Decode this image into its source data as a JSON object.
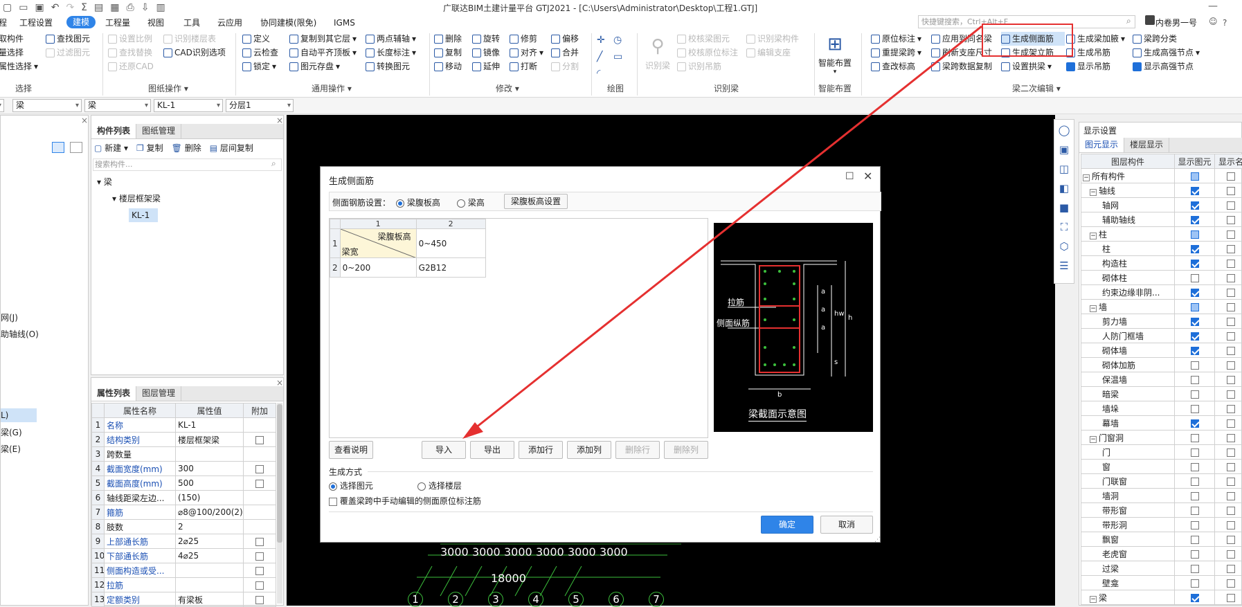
{
  "title": "广联达BIM土建计量平台 GTJ2021 - [C:\\Users\\Administrator\\Desktop\\工程1.GTJ]",
  "search_placeholder": "快捷键搜索，Ctrl+Alt+F",
  "user": "内卷男一号",
  "help": "?",
  "menu": [
    "程",
    "工程设置",
    "建模",
    "工程量",
    "视图",
    "工具",
    "云应用",
    "协同建模(限免)",
    "IGMS"
  ],
  "ribbon": {
    "select": {
      "items": [
        "取构件",
        "量选择",
        "属性选择",
        "查找图元",
        "过滤图元"
      ],
      "label": "选择"
    },
    "drawing": {
      "items": [
        "设置比例",
        "查找替换",
        "还原CAD",
        "识别楼层表",
        "CAD识别选项"
      ],
      "label": "图纸操作"
    },
    "common": {
      "items": [
        "定义",
        "云检查",
        "锁定",
        "复制到其它层",
        "自动平齐顶板",
        "图元存盘",
        "两点辅轴",
        "长度标注",
        "转换图元"
      ],
      "label": "通用操作"
    },
    "modify": {
      "items": [
        "删除",
        "复制",
        "移动",
        "旋转",
        "镜像",
        "延伸",
        "修剪",
        "对齐",
        "打断",
        "偏移",
        "合并",
        "分割"
      ],
      "label": "修改"
    },
    "draw": {
      "label": "绘图"
    },
    "identify": {
      "big": "识别梁",
      "items": [
        "校核梁图元",
        "校核原位标注",
        "识别吊筋",
        "编辑支座",
        "识别梁构件"
      ],
      "label": "识别梁"
    },
    "smart": {
      "big": "智能布置",
      "label": "智能布置"
    },
    "beam2": {
      "items": [
        "原位标注",
        "重提梁跨",
        "查改标高",
        "应用到同名梁",
        "刷新支座尺寸",
        "梁跨数据复制",
        "生成侧面筋",
        "生成架立筋",
        "设置拱梁",
        "生成梁加腋",
        "生成吊筋",
        "显示吊筋",
        "梁跨分类",
        "生成高强节点",
        "显示高强节点"
      ],
      "label": "梁二次编辑"
    }
  },
  "selectbar": [
    "梁",
    "梁",
    "KL-1",
    "分层1"
  ],
  "left_list": [
    "网(J)",
    "助轴线(O)",
    "L)",
    "梁(G)",
    "梁(E)"
  ],
  "component_panel": {
    "tabs": [
      "构件列表",
      "图纸管理"
    ],
    "toolbar": [
      "新建",
      "复制",
      "删除",
      "层间复制"
    ],
    "search_placeholder": "搜索构件...",
    "tree": [
      "梁",
      "楼层框架梁",
      "KL-1"
    ]
  },
  "property_panel": {
    "tabs": [
      "属性列表",
      "图层管理"
    ],
    "headers": [
      "属性名称",
      "属性值",
      "附加"
    ],
    "rows": [
      [
        "1",
        "名称",
        "KL-1"
      ],
      [
        "2",
        "结构类别",
        "楼层框架梁"
      ],
      [
        "3",
        "跨数量",
        ""
      ],
      [
        "4",
        "截面宽度(mm)",
        "300"
      ],
      [
        "5",
        "截面高度(mm)",
        "500"
      ],
      [
        "6",
        "轴线距梁左边...",
        "(150)"
      ],
      [
        "7",
        "箍筋",
        "⌀8@100/200(2)"
      ],
      [
        "8",
        "肢数",
        "2"
      ],
      [
        "9",
        "上部通长筋",
        "2⌀25"
      ],
      [
        "10",
        "下部通长筋",
        "4⌀25"
      ],
      [
        "11",
        "侧面构造或受...",
        ""
      ],
      [
        "12",
        "拉筋",
        ""
      ],
      [
        "13",
        "定额类别",
        "有梁板"
      ]
    ]
  },
  "dialog": {
    "title": "生成侧面筋",
    "setting_label": "侧面钢筋设置：",
    "opt1": "梁腹板高",
    "opt2": "梁高",
    "setting_btn": "梁腹板高设置",
    "table": {
      "cols": [
        "1",
        "2"
      ],
      "corner_top": "梁腹板高",
      "corner_bottom": "梁宽",
      "rows": [
        [
          "1",
          "",
          "0~450"
        ],
        [
          "2",
          "0~200",
          "G2B12"
        ]
      ]
    },
    "diagram": {
      "caption": "梁截面示意图",
      "lajin": "拉筋",
      "cemian": "侧面纵筋",
      "a": "a",
      "hw": "hw",
      "h": "h",
      "s": "s",
      "b": "b"
    },
    "buttons": [
      "查看说明",
      "导入",
      "导出",
      "添加行",
      "添加列",
      "删除行",
      "删除列"
    ],
    "method_label": "生成方式",
    "method1": "选择图元",
    "method2": "选择楼层",
    "override": "覆盖梁跨中手动编辑的侧面原位标注筋",
    "ok": "确定",
    "cancel": "取消"
  },
  "cad": {
    "dims": [
      "3000",
      "3000",
      "3000",
      "3000",
      "3000",
      "3000"
    ],
    "total": "18000",
    "axes": [
      "1",
      "2",
      "3",
      "4",
      "5",
      "6",
      "7"
    ]
  },
  "display_panel": {
    "title": "显示设置",
    "tabs": [
      "图元显示",
      "楼层显示"
    ],
    "headers": [
      "图层构件",
      "显示图元",
      "显示名"
    ],
    "rows": [
      [
        "所有构件",
        "part",
        0
      ],
      [
        "轴线",
        "on",
        1
      ],
      [
        "轴网",
        "on",
        2
      ],
      [
        "辅助轴线",
        "on",
        2
      ],
      [
        "柱",
        "part",
        1
      ],
      [
        "柱",
        "on",
        2
      ],
      [
        "构造柱",
        "on",
        2
      ],
      [
        "砌体柱",
        "off",
        2
      ],
      [
        "约束边缘非阴...",
        "on",
        2
      ],
      [
        "墙",
        "part",
        1
      ],
      [
        "剪力墙",
        "on",
        2
      ],
      [
        "人防门框墙",
        "on",
        2
      ],
      [
        "砌体墙",
        "on",
        2
      ],
      [
        "砌体加筋",
        "off",
        2
      ],
      [
        "保温墙",
        "off",
        2
      ],
      [
        "暗梁",
        "off",
        2
      ],
      [
        "墙垛",
        "off",
        2
      ],
      [
        "幕墙",
        "on",
        2
      ],
      [
        "门窗洞",
        "off",
        1
      ],
      [
        "门",
        "off",
        2
      ],
      [
        "窗",
        "off",
        2
      ],
      [
        "门联窗",
        "off",
        2
      ],
      [
        "墙洞",
        "off",
        2
      ],
      [
        "带形窗",
        "off",
        2
      ],
      [
        "带形洞",
        "off",
        2
      ],
      [
        "飘窗",
        "off",
        2
      ],
      [
        "老虎窗",
        "off",
        2
      ],
      [
        "过梁",
        "off",
        2
      ],
      [
        "壁龛",
        "off",
        2
      ],
      [
        "梁",
        "on",
        1
      ]
    ]
  }
}
